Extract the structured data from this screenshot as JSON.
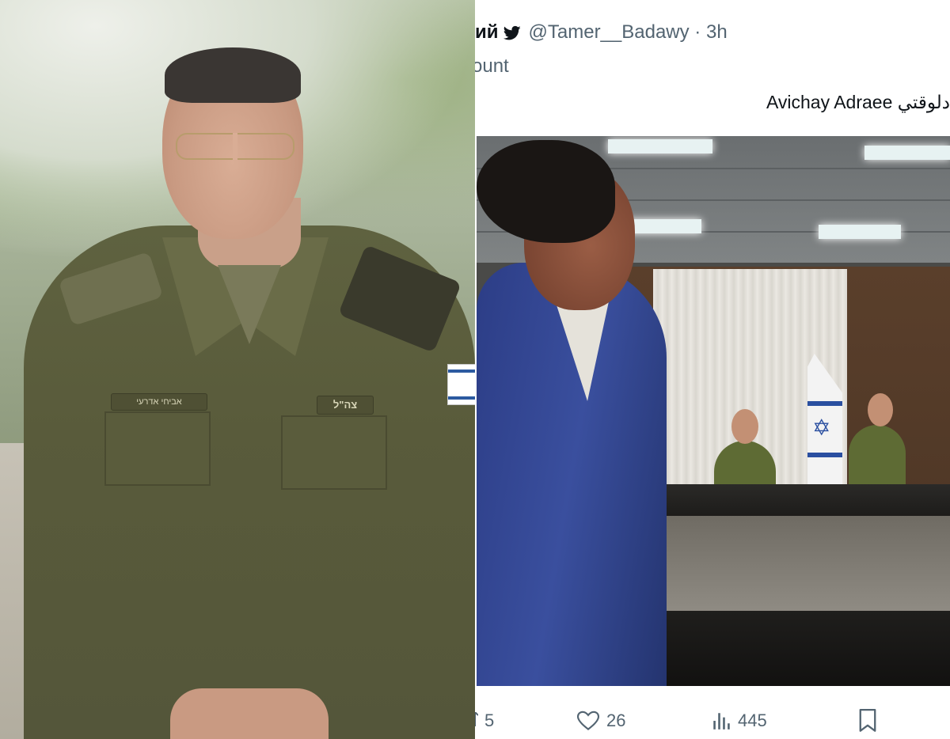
{
  "tweet": {
    "name_fragment": "ий",
    "handle": "@Tamer__Badawy",
    "separator": " · ",
    "time": "3h",
    "sub_line": "ount",
    "text": "Avichay Adraee دلوقتي"
  },
  "left_photo": {
    "name_tag": "אביחי אדרעי",
    "unit_tag": "צה\"ל"
  },
  "actions": {
    "retweets": "5",
    "likes": "26",
    "views": "445"
  },
  "colors": {
    "text_primary": "#0f1419",
    "text_secondary": "#536471",
    "twitter_icon": "#0f1419",
    "uniform": "#5f6240",
    "jacket_blue": "#3a4f9e"
  },
  "icons": {
    "bird": "twitter-bird-icon",
    "like": "heart-icon",
    "views": "bar-chart-icon",
    "bookmark": "bookmark-icon"
  }
}
